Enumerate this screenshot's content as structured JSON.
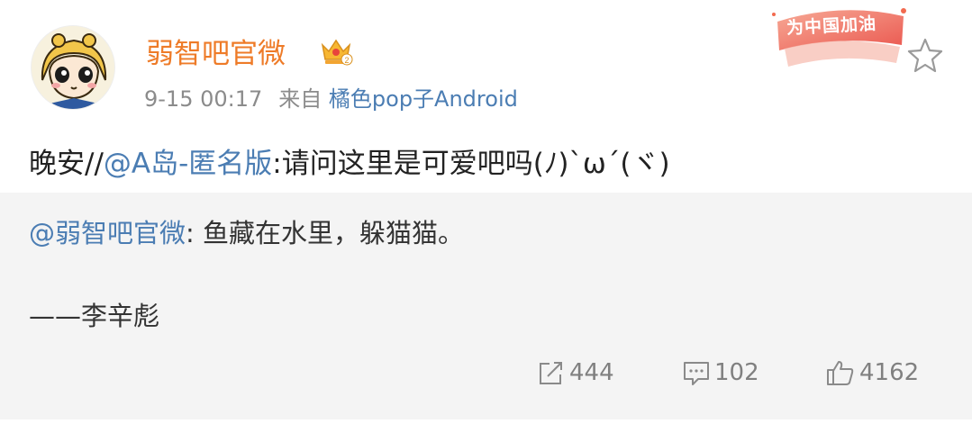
{
  "post": {
    "author": "弱智吧官微",
    "timestamp": "9-15 00:17",
    "source_prefix": "来自",
    "source_app": "橘色pop子Android",
    "text_prefix": "晚安//",
    "mention": "@A岛-匿名版",
    "text_suffix": ":请问这里是可爱吧吗(ﾉ)`ω´(ヾ)"
  },
  "repost": {
    "mention": "@弱智吧官微",
    "text": ": 鱼藏在水里，躲猫猫。",
    "signature": "——李辛彪"
  },
  "badge": {
    "text": "为中国加油"
  },
  "actions": {
    "share_count": "444",
    "comment_count": "102",
    "like_count": "4162"
  },
  "colors": {
    "username": "#ee7b28",
    "link": "#4b7db3",
    "meta": "#8b8b8b",
    "repost_bg": "#f4f4f4",
    "badge_red": "#e8453c"
  },
  "icons": [
    "vip-crown-icon",
    "star-icon",
    "share-icon",
    "comment-icon",
    "like-icon"
  ]
}
